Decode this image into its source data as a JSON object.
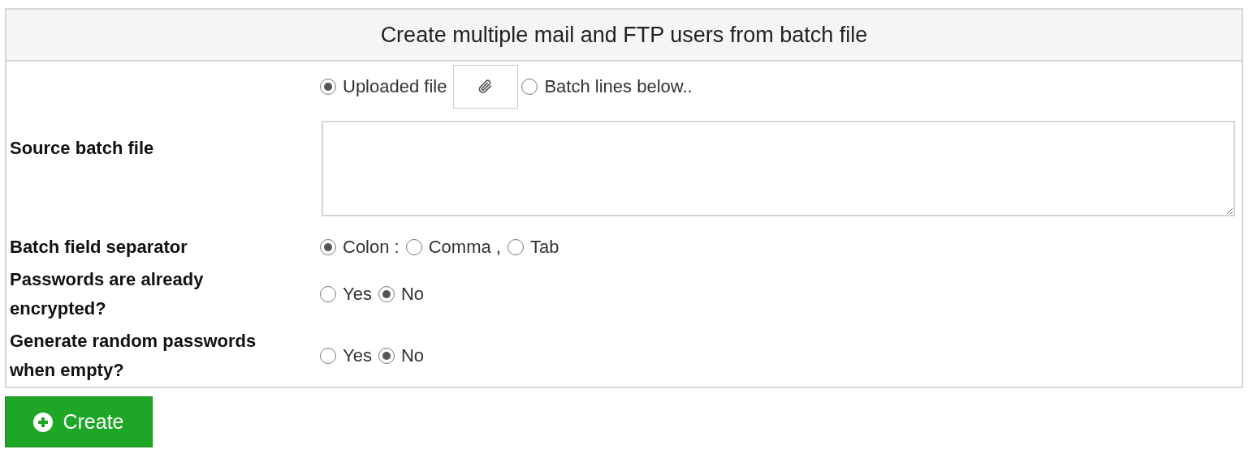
{
  "panel": {
    "title": "Create multiple mail and FTP users from batch file"
  },
  "fields": [
    {
      "kind": "source",
      "label": "Source batch file",
      "options": [
        {
          "label": "Uploaded file",
          "selected": true,
          "kind": "file"
        },
        {
          "label": "Batch lines below..",
          "selected": false,
          "kind": "plain"
        }
      ]
    },
    {
      "kind": "radios",
      "label": "Batch field separator",
      "options": [
        {
          "label": "Colon :",
          "selected": true,
          "kind": "plain"
        },
        {
          "label": "Comma ,",
          "selected": false,
          "kind": "plain"
        },
        {
          "label": "Tab",
          "selected": false,
          "kind": "plain"
        }
      ]
    },
    {
      "kind": "radios",
      "label": "Passwords are already encrypted?",
      "options": [
        {
          "label": "Yes",
          "selected": false,
          "kind": "plain"
        },
        {
          "label": "No",
          "selected": true,
          "kind": "plain"
        }
      ]
    },
    {
      "kind": "radios",
      "label": "Generate random passwords when empty?",
      "options": [
        {
          "label": "Yes",
          "selected": false,
          "kind": "plain"
        },
        {
          "label": "No",
          "selected": true,
          "kind": "plain"
        }
      ]
    }
  ],
  "button": {
    "label": "Create"
  }
}
